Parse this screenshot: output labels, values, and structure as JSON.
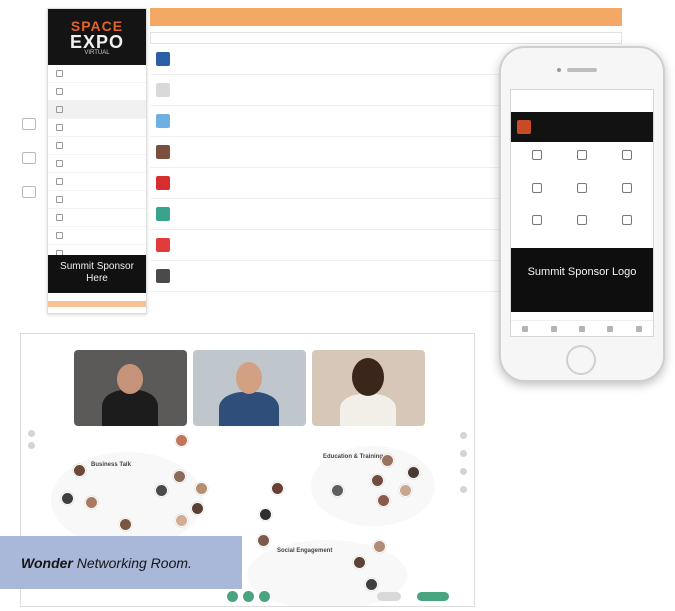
{
  "sidebar": {
    "logo": {
      "line1": "SPACE",
      "line2": "EXPO",
      "line3": "VIRTUAL"
    },
    "sponsor": "Summit Sponsor Here"
  },
  "phone": {
    "sponsor": "Summit Sponsor Logo"
  },
  "caption": {
    "bold": "Wonder",
    "rest": " Networking Room."
  },
  "room": {
    "circles": [
      "Business Talk",
      "Education & Training",
      "Social Engagement"
    ]
  },
  "colors": {
    "accent": "#f4a865",
    "caption_bg": "#a9b8d9",
    "button_green": "#47a67e"
  }
}
